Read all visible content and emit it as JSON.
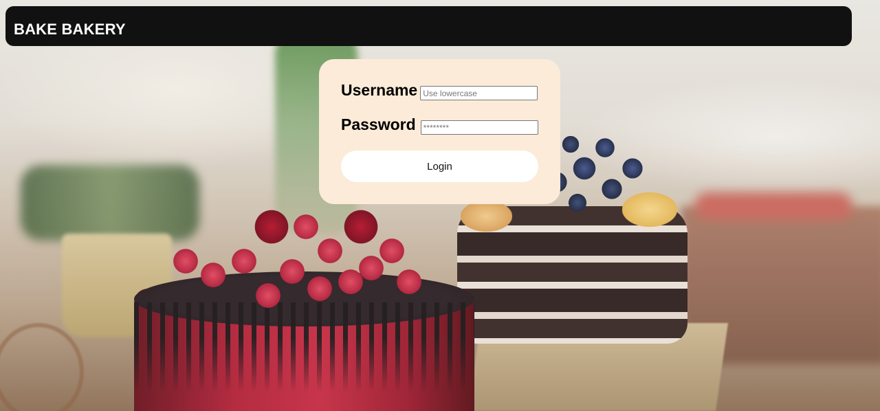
{
  "header": {
    "brand": "BAKE BAKERY",
    "background_color": "#111111"
  },
  "background": {
    "subject": "cakes-photo"
  },
  "login_form": {
    "card_color": "#fbebd8",
    "username": {
      "label": "Username",
      "placeholder": "Use lowercase",
      "value": ""
    },
    "password": {
      "label": "Password",
      "placeholder": "********",
      "value": ""
    },
    "submit_label": "Login"
  }
}
